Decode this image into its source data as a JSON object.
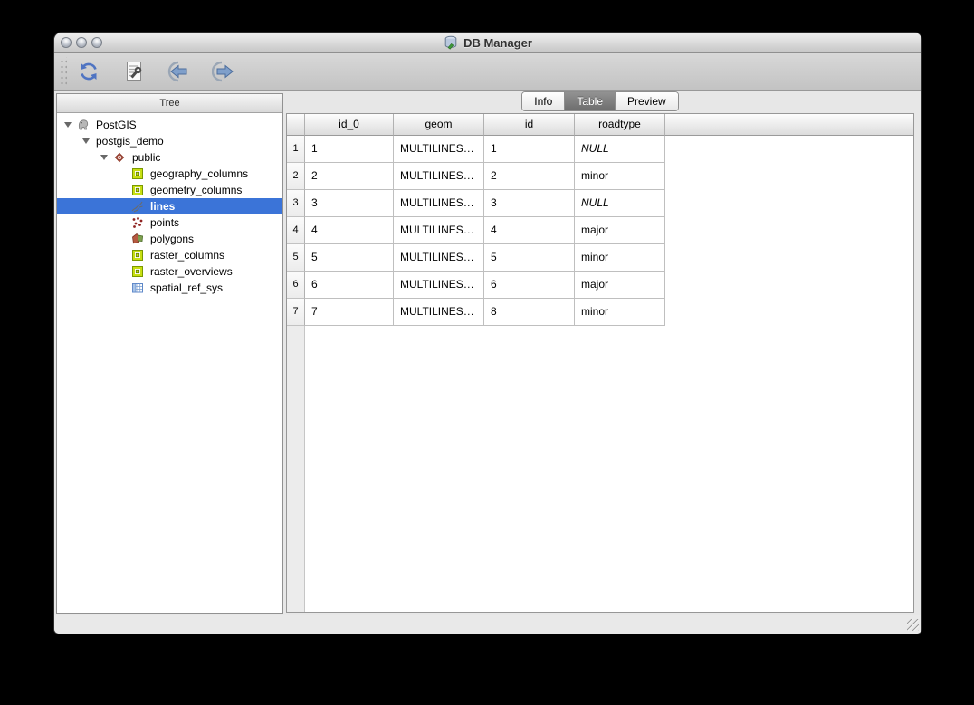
{
  "window": {
    "title": "DB Manager"
  },
  "titlebar_buttons": [
    {
      "name": "close-button"
    },
    {
      "name": "minimize-button"
    },
    {
      "name": "zoom-button"
    }
  ],
  "toolbar": {
    "buttons": [
      {
        "name": "refresh-button",
        "icon": "refresh-icon"
      },
      {
        "name": "sql-window-button",
        "icon": "sql-window-icon"
      },
      {
        "name": "import-layer-button",
        "icon": "import-icon"
      },
      {
        "name": "export-file-button",
        "icon": "export-icon"
      }
    ]
  },
  "tree": {
    "header": "Tree",
    "items": [
      {
        "label": "PostGIS",
        "level": 0,
        "icon": "postgis-icon",
        "expanded": true,
        "selected": false
      },
      {
        "label": "postgis_demo",
        "level": 1,
        "icon": null,
        "expanded": true,
        "selected": false
      },
      {
        "label": "public",
        "level": 2,
        "icon": "schema-icon",
        "expanded": true,
        "selected": false
      },
      {
        "label": "geography_columns",
        "level": 3,
        "icon": "table-icon",
        "expanded": false,
        "selected": false
      },
      {
        "label": "geometry_columns",
        "level": 3,
        "icon": "table-icon",
        "expanded": false,
        "selected": false
      },
      {
        "label": "lines",
        "level": 3,
        "icon": "line-layer-icon",
        "expanded": false,
        "selected": true
      },
      {
        "label": "points",
        "level": 3,
        "icon": "point-layer-icon",
        "expanded": false,
        "selected": false
      },
      {
        "label": "polygons",
        "level": 3,
        "icon": "polygon-layer-icon",
        "expanded": false,
        "selected": false
      },
      {
        "label": "raster_columns",
        "level": 3,
        "icon": "table-icon",
        "expanded": false,
        "selected": false
      },
      {
        "label": "raster_overviews",
        "level": 3,
        "icon": "table-icon",
        "expanded": false,
        "selected": false
      },
      {
        "label": "spatial_ref_sys",
        "level": 3,
        "icon": "spatial-table-icon",
        "expanded": false,
        "selected": false
      }
    ]
  },
  "tabs": [
    {
      "label": "Info",
      "active": false
    },
    {
      "label": "Table",
      "active": true
    },
    {
      "label": "Preview",
      "active": false
    }
  ],
  "table": {
    "columns": [
      "id_0",
      "geom",
      "id",
      "roadtype"
    ],
    "rows": [
      {
        "num": "1",
        "cells": [
          "1",
          "MULTILINES…",
          "1",
          "NULL"
        ]
      },
      {
        "num": "2",
        "cells": [
          "2",
          "MULTILINES…",
          "2",
          "minor"
        ]
      },
      {
        "num": "3",
        "cells": [
          "3",
          "MULTILINES…",
          "3",
          "NULL"
        ]
      },
      {
        "num": "4",
        "cells": [
          "4",
          "MULTILINES…",
          "4",
          "major"
        ]
      },
      {
        "num": "5",
        "cells": [
          "5",
          "MULTILINES…",
          "5",
          "minor"
        ]
      },
      {
        "num": "6",
        "cells": [
          "6",
          "MULTILINES…",
          "6",
          "major"
        ]
      },
      {
        "num": "7",
        "cells": [
          "7",
          "MULTILINES…",
          "8",
          "minor"
        ]
      }
    ]
  },
  "colors": {
    "selection_blue": "#3b74d8",
    "tab_active_gray": "#7a7a7a",
    "table_icon_green": "#c8df12",
    "schema_icon_red": "#cf6f60",
    "toolbar_icon_blue": "#7f9fca"
  }
}
